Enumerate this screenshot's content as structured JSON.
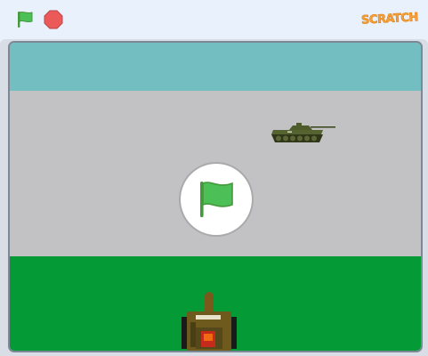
{
  "toolbar": {
    "green_flag_icon": "green-flag-icon",
    "stop_icon": "stop-sign-icon",
    "logo_text": "SCRATCH"
  },
  "stage": {
    "sky_color": "#72bec1",
    "road_color": "#c2c2c4",
    "grass_color": "#049a36",
    "sprites": [
      "enemy-tank",
      "player-tank"
    ],
    "overlay_icon": "green-flag-icon"
  },
  "colors": {
    "flag_green": "#4cbf56",
    "stop_red": "#ec5959",
    "logo_orange": "#f7a13a"
  }
}
